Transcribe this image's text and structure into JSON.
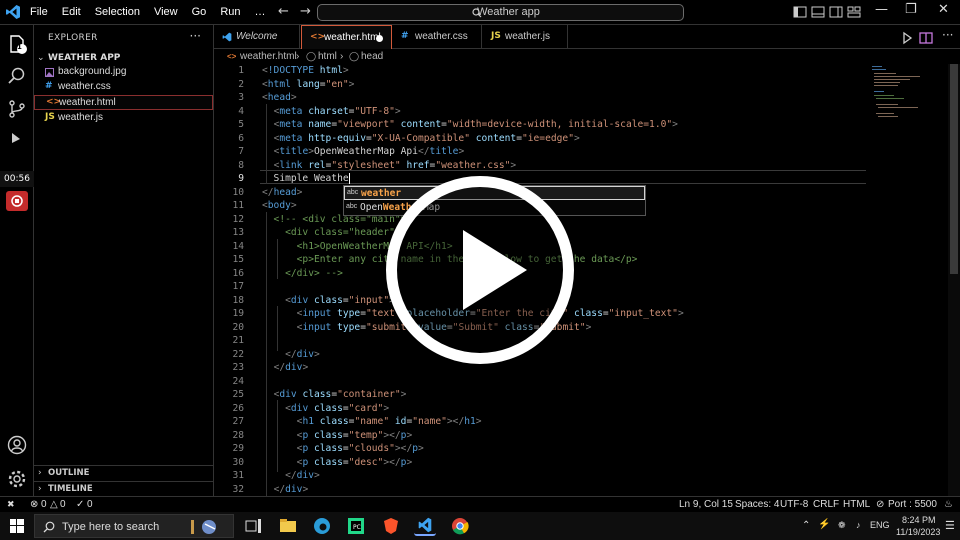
{
  "menu": [
    "File",
    "Edit",
    "Selection",
    "View",
    "Go",
    "Run",
    "…"
  ],
  "command_center": "Weather app",
  "activity": {
    "source_control_badge": "1",
    "timer": "00:56"
  },
  "explorer": {
    "title": "EXPLORER",
    "project": "WEATHER APP",
    "files": [
      {
        "name": "background.jpg",
        "icon": "image-icon",
        "selected": false
      },
      {
        "name": "weather.css",
        "icon": "css-icon",
        "selected": false
      },
      {
        "name": "weather.html",
        "icon": "html-icon",
        "selected": true
      },
      {
        "name": "weather.js",
        "icon": "js-icon",
        "selected": false
      }
    ],
    "outline": "OUTLINE",
    "timeline": "TIMELINE"
  },
  "tabs": [
    {
      "label": "Welcome",
      "icon": "vscode-icon"
    },
    {
      "label": "weather.html",
      "icon": "html-icon",
      "active": true,
      "dirty": true
    },
    {
      "label": "weather.css",
      "icon": "css-icon"
    },
    {
      "label": "weather.js",
      "icon": "js-icon"
    }
  ],
  "breadcrumb": [
    "weather.html",
    "html",
    "head"
  ],
  "editor": {
    "lines": [
      "1",
      "2",
      "3",
      "4",
      "5",
      "6",
      "7",
      "8",
      "9",
      "10",
      "11",
      "12",
      "13",
      "14",
      "15",
      "16",
      "17",
      "18",
      "19",
      "20",
      "21",
      "22",
      "23",
      "24",
      "25",
      "26",
      "27",
      "28",
      "29",
      "30",
      "31",
      "32"
    ],
    "current_line": "9"
  },
  "suggestions": [
    {
      "match": "weather",
      "rest": ""
    },
    {
      "prefix": "Open",
      "match": "Weather",
      "rest": "Map"
    }
  ],
  "status": {
    "remote": "✖",
    "errors": "0",
    "warnings": "0",
    "ports": "0",
    "position": "Ln 9, Col 15",
    "spaces": "Spaces: 4",
    "encoding": "UTF-8",
    "eol": "CRLF",
    "language": "HTML",
    "live_server": "Port : 5500"
  },
  "taskbar": {
    "search_placeholder": "Type here to search",
    "language": "ENG",
    "time": "8:24 PM",
    "date": "11/19/2023"
  },
  "colors": {
    "accent_tab": "#d35a3a",
    "keyword": "#569cd6",
    "attribute": "#9cdcfe",
    "string": "#ce9178",
    "comment": "#6a9955"
  }
}
